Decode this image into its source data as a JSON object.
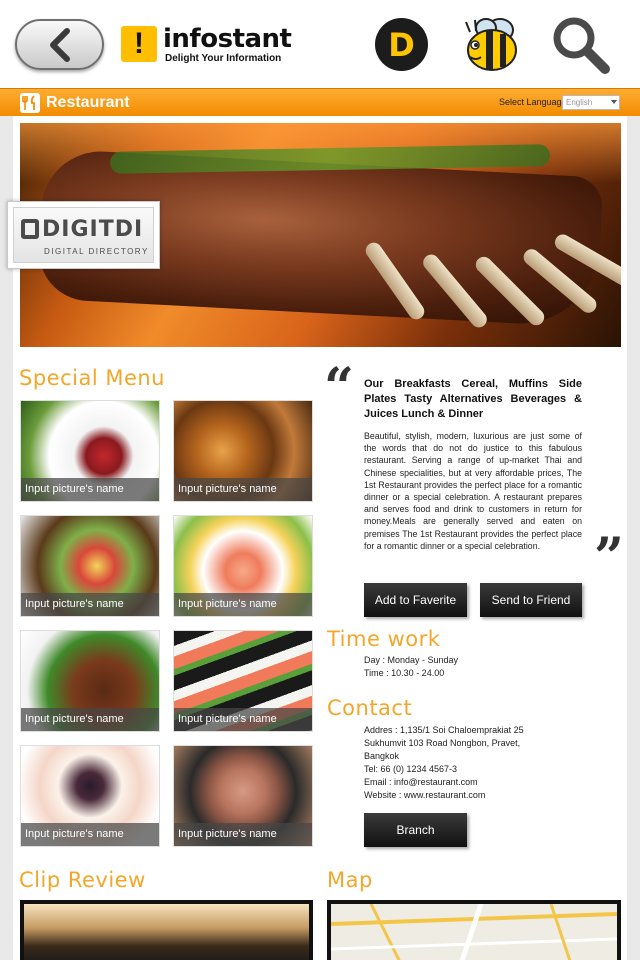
{
  "header": {
    "logo_mark": "!",
    "logo_name": "infostant",
    "logo_tagline": "Delight Your Information",
    "d_icon_letter": "D"
  },
  "subbar": {
    "title": "Restaurant",
    "language_label": "Select Language",
    "language_value": "English"
  },
  "banner": {
    "brand": "DIGITDI",
    "brand_sub": "DIGITAL DIRECTORY"
  },
  "special_menu": {
    "title": "Special Menu",
    "items": [
      {
        "caption": "Input picture's name"
      },
      {
        "caption": "Input picture's name"
      },
      {
        "caption": "Input picture's name"
      },
      {
        "caption": "Input picture's name"
      },
      {
        "caption": "Input picture's name"
      },
      {
        "caption": "Input picture's name"
      },
      {
        "caption": "Input picture's name"
      },
      {
        "caption": "Input picture's name"
      }
    ]
  },
  "intro": {
    "title": "Our Breakfasts Cereal, Muffins Side Plates Tasty Alternatives Beverages & Juices Lunch & Dinner",
    "body": "Beautiful, stylish, modern, luxurious are just some of the words that do not do justice to this fabulous restaurant. Serving a range of up-market Thai and Chinese specialities, but at very affordable prices, The 1st Restaurant provides the perfect place for a romantic dinner or a special celebration. A restaurant prepares and serves food and drink to customers in return for money.Meals are generally served and eaten on premises The 1st Restaurant provides the perfect place for a romantic dinner or a special celebration."
  },
  "actions": {
    "favorite": "Add to Faverite",
    "send": "Send to Friend",
    "branch": "Branch"
  },
  "time_work": {
    "title": "Time work",
    "day": "Day : Monday - Sunday",
    "time": "Time : 10.30 - 24.00"
  },
  "contact": {
    "title": "Contact",
    "address_1": "Addres : 1,135/1 Soi Chaloemprakiat 25",
    "address_2": "Sukhumvit 103 Road Nongbon, Pravet,",
    "address_3": "Bangkok",
    "tel": "Tel: 66 (0) 1234 4567-3",
    "email": "Email : info@restaurant.com",
    "website": "Website : www.restaurant.com"
  },
  "clip_review": {
    "title": "Clip Review"
  },
  "map": {
    "title": "Map"
  },
  "colors": {
    "accent": "#f5a629",
    "bar": "#f28c00"
  }
}
